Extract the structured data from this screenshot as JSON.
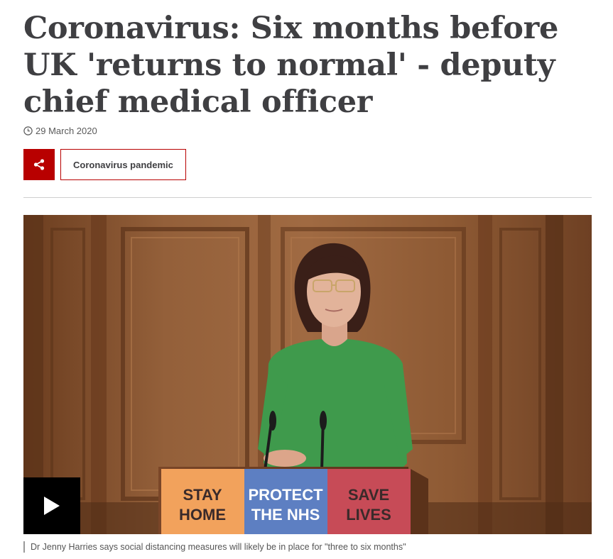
{
  "article": {
    "headline": "Coronavirus: Six months before UK 'returns to normal' - deputy chief medical officer",
    "date": "29 March 2020",
    "share_icon": "share-icon",
    "tag_label": "Coronavirus pandemic"
  },
  "media": {
    "podium": {
      "panel1_line1": "STAY",
      "panel1_line2": "HOME",
      "panel2_line1": "PROTECT",
      "panel2_line2": "THE NHS",
      "panel3_line1": "SAVE",
      "panel3_line2": "LIVES"
    },
    "play_icon": "play-icon",
    "caption": "Dr Jenny Harries says social distancing measures will likely be in place for \"three to six months\""
  },
  "colors": {
    "brand_red": "#b80000",
    "panel_orange": "#f2a25c",
    "panel_blue": "#5d7fc2",
    "panel_red": "#c74b57"
  }
}
